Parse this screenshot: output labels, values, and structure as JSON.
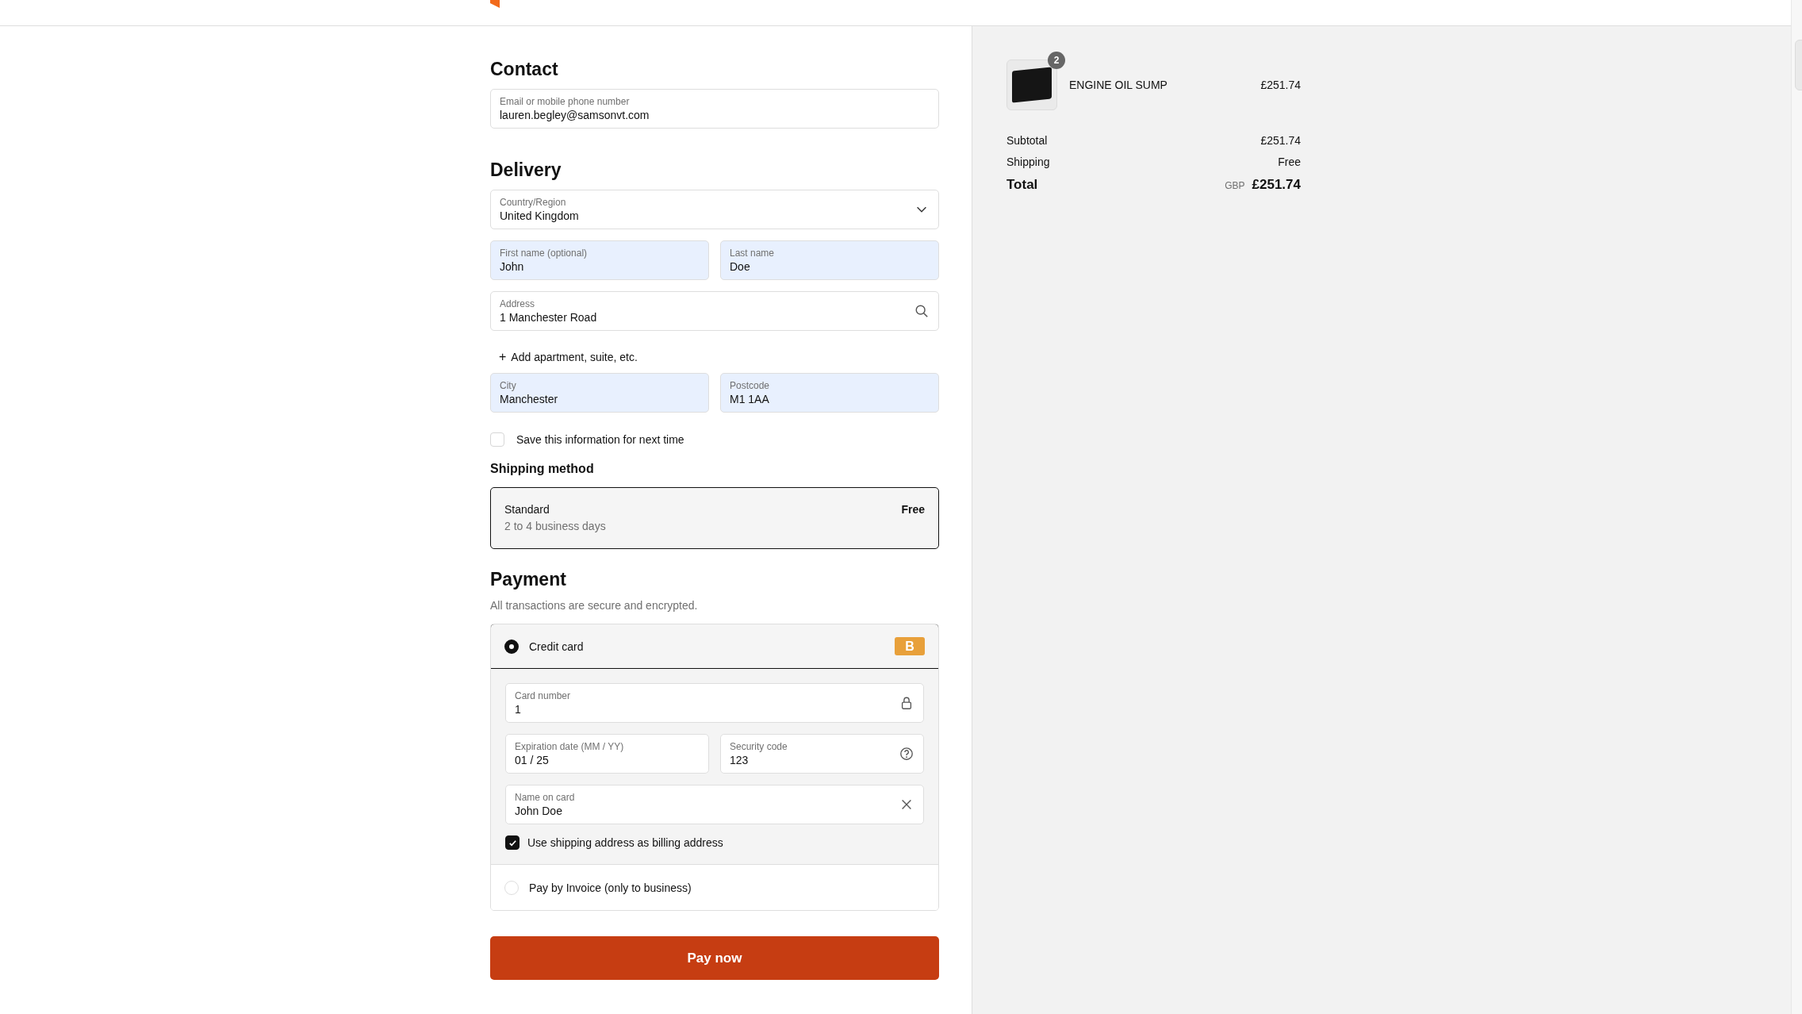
{
  "contact": {
    "title": "Contact",
    "rows": [
      [
        {
          "label": "Email or mobile phone number",
          "value": "lauren.begley@samsonvt.com",
          "autofilled": false
        }
      ]
    ]
  },
  "delivery": {
    "title": "Delivery",
    "rows": [
      [
        {
          "label": "Country/Region",
          "value": "United Kingdom",
          "autofilled": false,
          "kind": "chevron"
        }
      ],
      [
        {
          "label": "First name (optional)",
          "value": "John",
          "autofilled": true
        },
        {
          "label": "Last name",
          "value": "Doe",
          "autofilled": true
        }
      ],
      [
        {
          "label": "Address",
          "value": "1 Manchester Road",
          "autofilled": false,
          "kind": "search"
        }
      ]
    ],
    "add_link": {
      "icon": "+",
      "label": "Add apartment, suite, etc."
    },
    "rows_after": [
      [
        {
          "label": "City",
          "value": "Manchester",
          "autofilled": true
        },
        {
          "label": "Postcode",
          "value": "M1 1AA",
          "autofilled": true
        }
      ]
    ],
    "save": {
      "label": "Save this information for next time",
      "checked": false
    }
  },
  "shipping": {
    "title": "Shipping method",
    "options": [
      {
        "name": "Standard",
        "detail": "2 to 4 business days",
        "price": "Free",
        "selected": true
      }
    ]
  },
  "payment": {
    "title": "Payment",
    "subtitle": "All transactions are secure and encrypted.",
    "methods": [
      {
        "label": "Credit card",
        "selected": true,
        "badge": "B",
        "rows": [
          [
            {
              "label": "Card number",
              "value": "1",
              "autofilled": false,
              "kind": "lock"
            }
          ],
          [
            {
              "label": "Expiration date (MM / YY)",
              "value": "01 / 25",
              "autofilled": false
            },
            {
              "label": "Security code",
              "value": "123",
              "autofilled": false,
              "kind": "help"
            }
          ],
          [
            {
              "label": "Name on card",
              "value": "John Doe",
              "autofilled": false,
              "kind": "clear"
            }
          ]
        ],
        "billing": {
          "label": "Use shipping address as billing address",
          "checked": true
        }
      },
      {
        "label": "Pay by Invoice (only to business)",
        "selected": false
      }
    ]
  },
  "pay_button": "Pay now",
  "summary": {
    "items": [
      {
        "name": "ENGINE OIL SUMP",
        "price": "£251.74",
        "quantity": "2"
      }
    ],
    "lines": [
      {
        "label": "Subtotal",
        "value": "£251.74"
      },
      {
        "label": "Shipping",
        "value": "Free"
      }
    ],
    "total": {
      "label": "Total",
      "currency": "GBP",
      "value": "£251.74"
    }
  }
}
